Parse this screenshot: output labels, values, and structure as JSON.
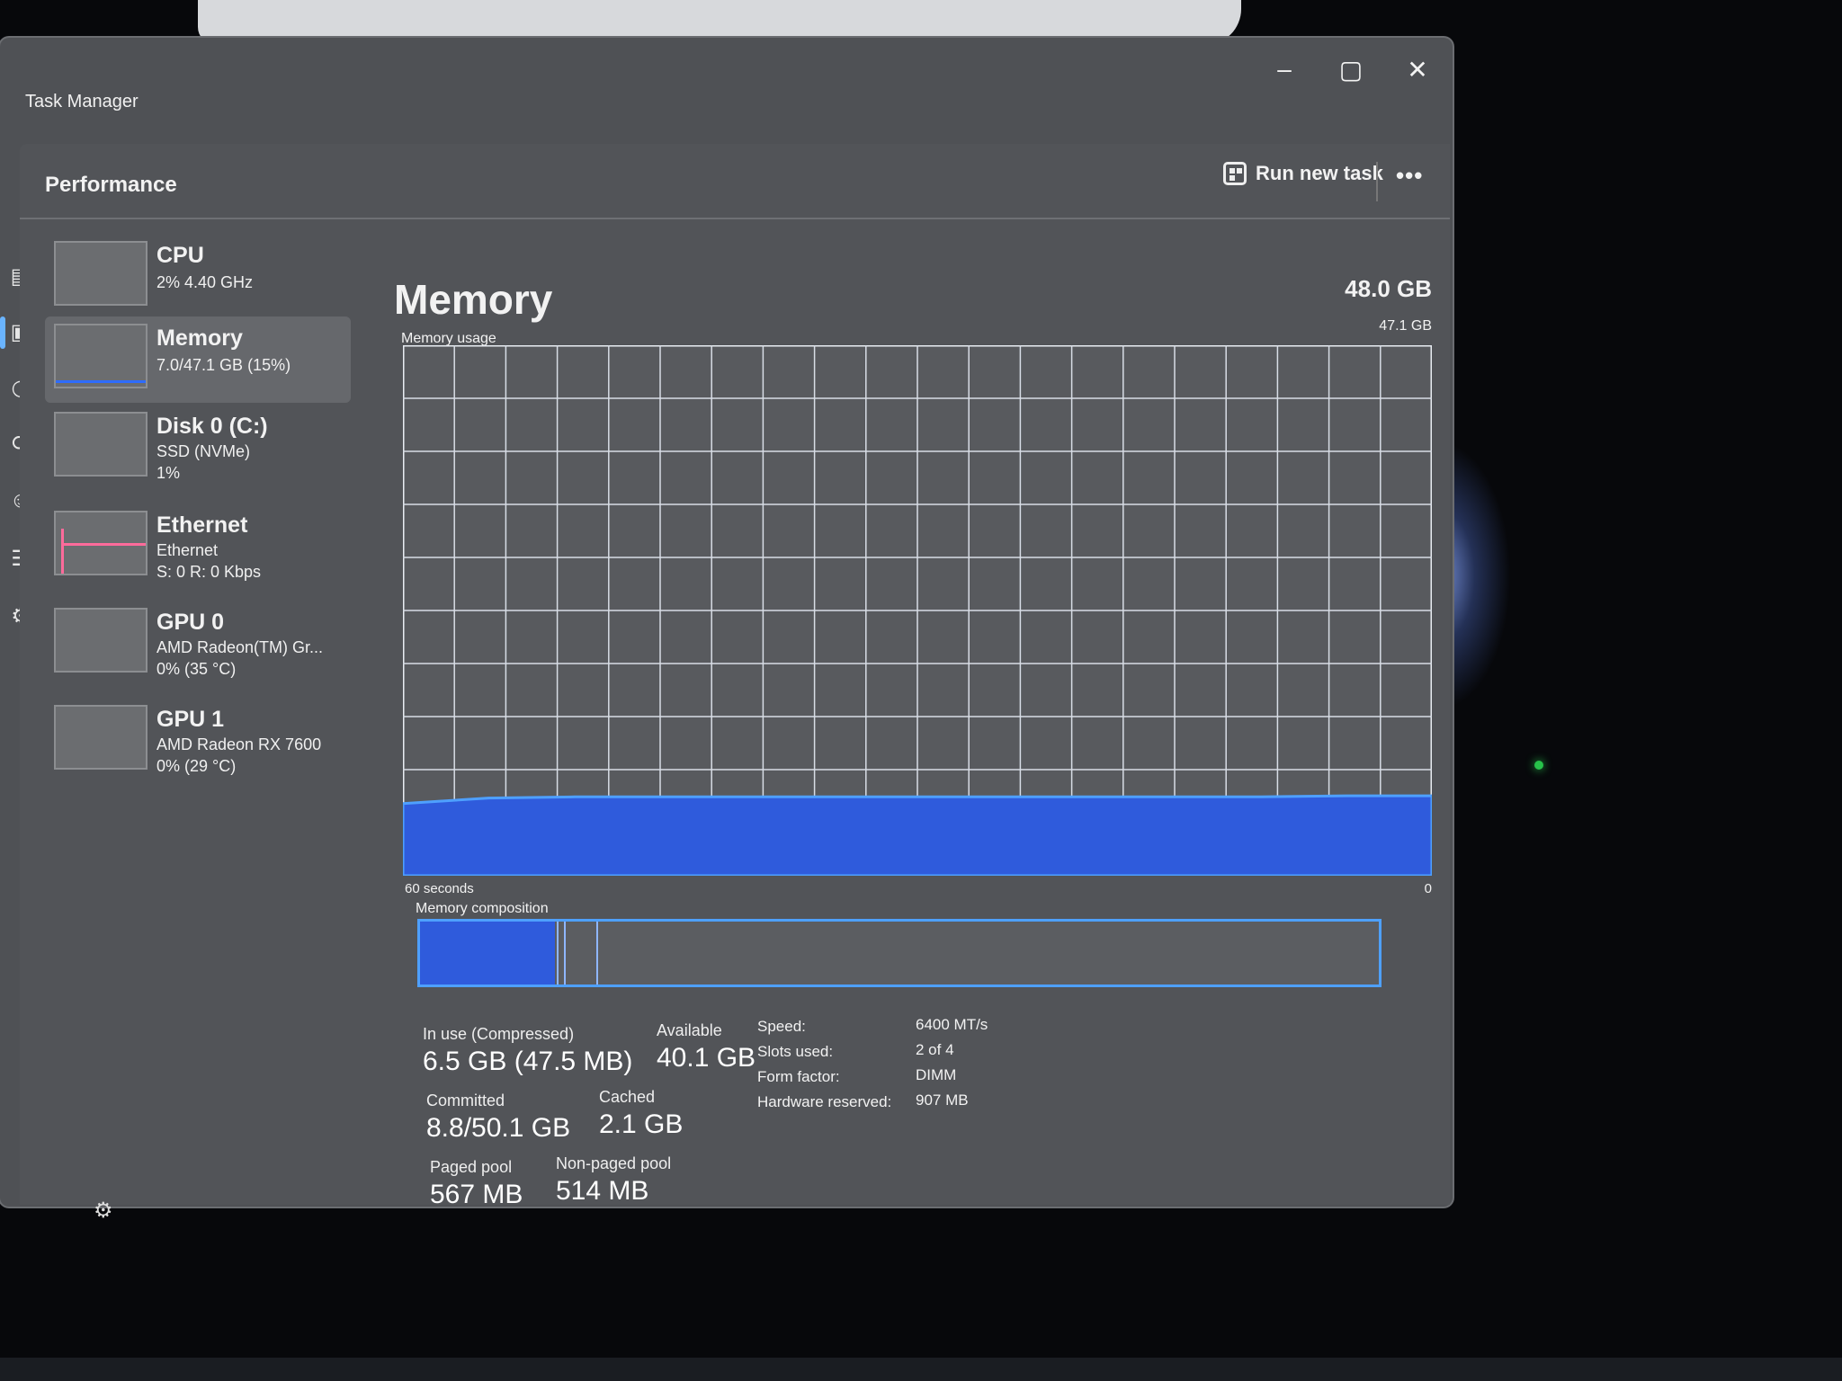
{
  "window": {
    "title": "Task Manager",
    "controls": {
      "minimize": "–",
      "maximize": "▢",
      "close": "✕"
    }
  },
  "nav": [
    {
      "icon": "processes-icon",
      "glyph": "▤"
    },
    {
      "icon": "performance-icon",
      "glyph": "▣"
    },
    {
      "icon": "history-icon",
      "glyph": "◷"
    },
    {
      "icon": "startup-icon",
      "glyph": "⟳"
    },
    {
      "icon": "users-icon",
      "glyph": "☺"
    },
    {
      "icon": "details-icon",
      "glyph": "☰"
    },
    {
      "icon": "services-icon",
      "glyph": "⚙"
    }
  ],
  "header": {
    "title": "Performance",
    "run_new_task": "Run new task",
    "more": "•••"
  },
  "devices": [
    {
      "name": "CPU",
      "lines": [
        "2% 4.40 GHz"
      ],
      "selected": false
    },
    {
      "name": "Memory",
      "lines": [
        "7.0/47.1 GB (15%)"
      ],
      "selected": true
    },
    {
      "name": "Disk 0 (C:)",
      "lines": [
        "SSD (NVMe)",
        "1%"
      ],
      "selected": false
    },
    {
      "name": "Ethernet",
      "lines": [
        "Ethernet",
        "S: 0 R: 0 Kbps"
      ],
      "selected": false
    },
    {
      "name": "GPU 0",
      "lines": [
        "AMD Radeon(TM) Gr...",
        "0% (35 °C)"
      ],
      "selected": false
    },
    {
      "name": "GPU 1",
      "lines": [
        "AMD Radeon RX 7600",
        "0% (29 °C)"
      ],
      "selected": false
    }
  ],
  "main": {
    "title": "Memory",
    "total": "48.0 GB",
    "graph_label": "Memory usage",
    "graph_max": "47.1 GB",
    "axis_left": "60 seconds",
    "axis_right": "0",
    "composition_label": "Memory composition"
  },
  "chart_data": {
    "type": "area",
    "xlabel": "60 seconds",
    "x": [
      60,
      55,
      50,
      45,
      40,
      35,
      30,
      25,
      20,
      15,
      10,
      5,
      0
    ],
    "values": [
      6.4,
      6.9,
      7.0,
      7.0,
      7.0,
      7.0,
      7.0,
      7.0,
      7.0,
      7.0,
      7.0,
      7.1,
      7.1
    ],
    "ylim": [
      0,
      47.1
    ],
    "ymax_label": "47.1 GB",
    "color": "#2f5bdc",
    "grid": true
  },
  "stats": {
    "in_use_label": "In use (Compressed)",
    "in_use_value": "6.5 GB (47.5 MB)",
    "available_label": "Available",
    "available_value": "40.1 GB",
    "committed_label": "Committed",
    "committed_value": "8.8/50.1 GB",
    "cached_label": "Cached",
    "cached_value": "2.1 GB",
    "paged_label": "Paged pool",
    "paged_value": "567 MB",
    "nonpaged_label": "Non-paged pool",
    "nonpaged_value": "514 MB"
  },
  "specs": [
    {
      "label": "Speed:",
      "value": "6400 MT/s"
    },
    {
      "label": "Slots used:",
      "value": "2 of 4"
    },
    {
      "label": "Form factor:",
      "value": "DIMM"
    },
    {
      "label": "Hardware reserved:",
      "value": "907 MB"
    }
  ],
  "colors": {
    "accent": "#4ea0ff",
    "memory": "#2f5bdc",
    "ethernet": "#ff6b9b"
  }
}
